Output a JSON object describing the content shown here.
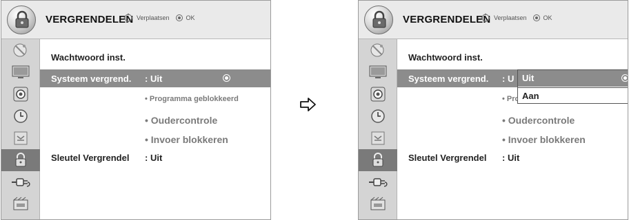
{
  "menu": {
    "title": "VERGRENDELEN",
    "hint_move": "Verplaatsen",
    "hint_ok": "OK",
    "sidebar_icons": [
      "satellite-icon",
      "monitor-icon",
      "speaker-icon",
      "clock-icon",
      "input-icon",
      "lock-icon",
      "plug-icon",
      "media-icon"
    ],
    "active_icon_index": 5,
    "rows": {
      "password": {
        "label": "Wachtwoord inst."
      },
      "system_lock": {
        "label": "Systeem vergrend.",
        "value": ": Uit",
        "value_short": ": U"
      },
      "key_lock": {
        "label": "Sleutel Vergrendel",
        "value": ": Uit"
      }
    },
    "sub_items": {
      "block_program": "• Programma geblokkeerd",
      "block_program_partial": "• Progr",
      "parental": "• Oudercontrole",
      "input_block": "• Invoer blokkeren"
    }
  },
  "dropdown": {
    "options": [
      "Uit",
      "Aan"
    ],
    "selected": "Uit"
  }
}
